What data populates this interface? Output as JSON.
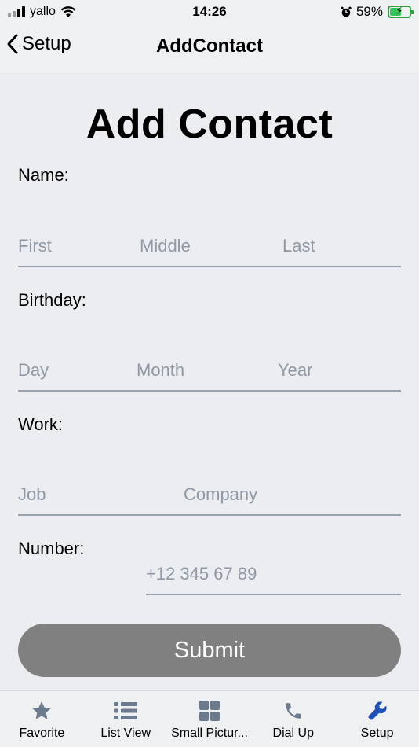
{
  "status_bar": {
    "carrier": "yallo",
    "time": "14:26",
    "battery": "59%",
    "battery_level": 0.59
  },
  "nav": {
    "back_label": "Setup",
    "title": "AddContact"
  },
  "form": {
    "title": "Add Contact",
    "name": {
      "label": "Name:",
      "first_placeholder": "First",
      "middle_placeholder": "Middle",
      "last_placeholder": "Last"
    },
    "birthday": {
      "label": "Birthday:",
      "day_placeholder": "Day",
      "month_placeholder": "Month",
      "year_placeholder": "Year"
    },
    "work": {
      "label": "Work:",
      "job_placeholder": "Job",
      "company_placeholder": "Company"
    },
    "number": {
      "label": "Number:",
      "placeholder": "+12 345 67 89"
    },
    "submit_label": "Submit"
  },
  "tabs": [
    {
      "label": "Favorite",
      "icon": "star-icon"
    },
    {
      "label": "List View",
      "icon": "list-icon"
    },
    {
      "label": "Small Pictur...",
      "icon": "grid-icon"
    },
    {
      "label": "Dial Up",
      "icon": "phone-icon"
    },
    {
      "label": "Setup",
      "icon": "wrench-icon",
      "active": true
    }
  ],
  "colors": {
    "accent": "#1f4fb8",
    "icon_inactive": "#6b7a8d",
    "placeholder": "#8f99a6",
    "submit_bg": "#808080"
  }
}
